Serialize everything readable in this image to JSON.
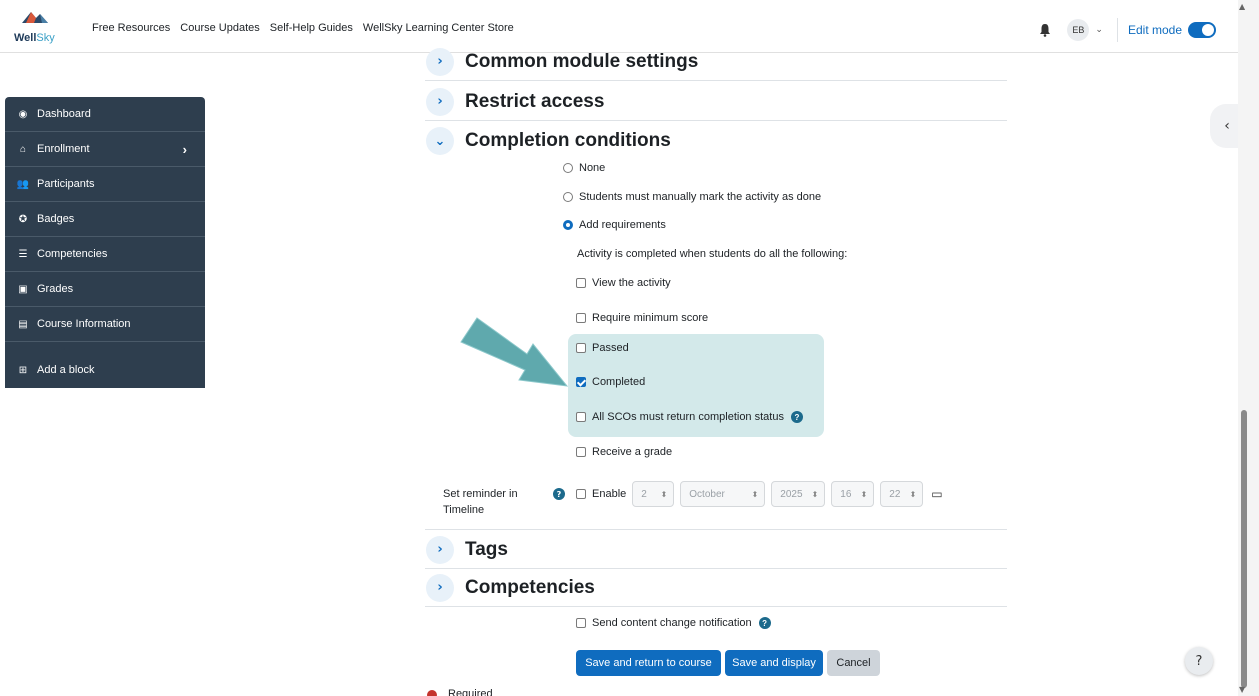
{
  "brand": {
    "logo_word": "Well",
    "logo_word2": "Sky"
  },
  "nav": {
    "links": [
      "Free Resources",
      "Course Updates",
      "Self-Help Guides",
      "WellSky Learning Center Store"
    ],
    "user_initials": "EB",
    "edit_mode_label": "Edit mode"
  },
  "sidebar": {
    "items": [
      {
        "label": "Dashboard",
        "icon": "dashboard-icon",
        "glyph": "◉"
      },
      {
        "label": "Enrollment",
        "icon": "bank-icon",
        "glyph": "⌂"
      },
      {
        "label": "Participants",
        "icon": "users-icon",
        "glyph": "👥"
      },
      {
        "label": "Badges",
        "icon": "badge-icon",
        "glyph": "✪"
      },
      {
        "label": "Competencies",
        "icon": "list-icon",
        "glyph": "☰"
      },
      {
        "label": "Grades",
        "icon": "clipboard-icon",
        "glyph": "▣"
      },
      {
        "label": "Course Information",
        "icon": "table-icon",
        "glyph": "▤"
      }
    ],
    "add_block": "Add a block"
  },
  "sections": {
    "common": "Common module settings",
    "restrict": "Restrict access",
    "completion": "Completion conditions",
    "tags": "Tags",
    "competencies": "Competencies"
  },
  "completion": {
    "opt_none": "None",
    "opt_manual": "Students must manually mark the activity as done",
    "opt_add": "Add requirements",
    "instruction": "Activity is completed when students do all the following:",
    "view": "View the activity",
    "min_score": "Require minimum score",
    "passed": "Passed",
    "completed": "Completed",
    "all_scos": "All SCOs must return completion status",
    "grade": "Receive a grade"
  },
  "reminder": {
    "label": "Set reminder in Timeline",
    "enable": "Enable",
    "day": "2",
    "month": "October",
    "year": "2025",
    "hour": "16",
    "minute": "22"
  },
  "notify": "Send content change notification",
  "buttons": {
    "save_return": "Save and return to course",
    "save_display": "Save and display",
    "cancel": "Cancel"
  },
  "help_fab": "?",
  "help_mark": "?",
  "required_text": "Required",
  "colors": {
    "primary": "#0f6cbf",
    "sidebar": "#2e3e4e",
    "highlight": "#d3e9ea",
    "arrow": "#5fa9ad"
  }
}
